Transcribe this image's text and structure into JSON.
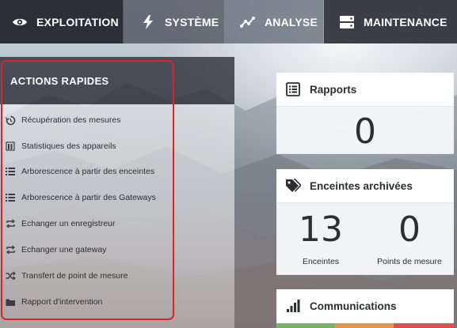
{
  "nav": {
    "items": [
      {
        "label": "EXPLOITATION",
        "icon": "eye-icon",
        "active": true
      },
      {
        "label": "SYSTÈME",
        "icon": "lightning-icon",
        "active": false
      },
      {
        "label": "ANALYSE",
        "icon": "line-chart-icon",
        "active": false
      },
      {
        "label": "MAINTENANCE",
        "icon": "server-icon",
        "active": false
      }
    ]
  },
  "quick_actions": {
    "title": "ACTIONS RAPIDES",
    "items": [
      {
        "label": "Récupération des mesures",
        "icon": "retrieve-icon"
      },
      {
        "label": "Statistiques des appareils",
        "icon": "stats-icon"
      },
      {
        "label": "Arborescence à partir des enceintes",
        "icon": "list-icon"
      },
      {
        "label": "Arborescence à partir des Gateways",
        "icon": "list-icon"
      },
      {
        "label": "Echanger un enregistreur",
        "icon": "exchange-icon"
      },
      {
        "label": "Echanger une gateway",
        "icon": "exchange-icon"
      },
      {
        "label": "Transfert de point de mesure",
        "icon": "shuffle-icon"
      },
      {
        "label": "Rapport d'intervention",
        "icon": "folder-icon"
      }
    ]
  },
  "cards": {
    "rapports": {
      "title": "Rapports",
      "icon": "report-icon",
      "value": "0"
    },
    "enceintes": {
      "title": "Enceintes archivées",
      "icon": "tags-icon",
      "stats": [
        {
          "value": "13",
          "label": "Enceintes"
        },
        {
          "value": "0",
          "label": "Points de mesure"
        }
      ]
    },
    "communications": {
      "title": "Communications",
      "icon": "signal-bars-icon"
    }
  },
  "colors": {
    "nav_active": "#2b2f36",
    "highlight": "#e0202a",
    "status_green": "#79b466",
    "status_orange": "#e8944a",
    "status_red": "#d9534f"
  }
}
